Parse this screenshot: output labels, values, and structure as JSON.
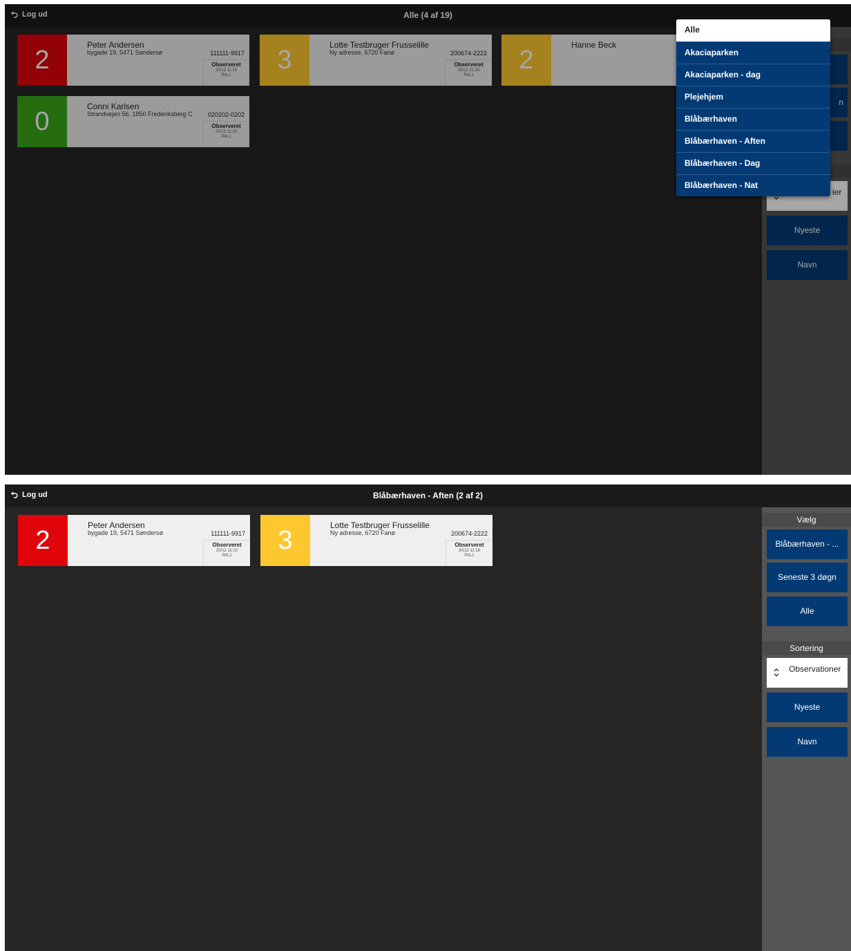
{
  "colors": {
    "red": "#e0040b",
    "yellow": "#fdc82f",
    "green": "#3aa71a",
    "blue": "#033a73",
    "background": "#252525",
    "topbar": "#1b1b1b",
    "sidebar": "#555555"
  },
  "common": {
    "logout_label": "Log ud",
    "logout_icon": "undo-arrow-icon"
  },
  "screen1": {
    "title": "Alle (4 af 19)",
    "patients": [
      {
        "score": "2",
        "color": "red",
        "name": "Peter Andersen",
        "address": "bygade 19, 5471 Søndersø",
        "id": "111111-9917",
        "obs_label": "Observeret",
        "obs_time": "20/12 11:15",
        "obs_code": "PAL1"
      },
      {
        "score": "3",
        "color": "yellow",
        "name": "Lotte Testbruger Frusselille",
        "address": "Ny adresse, 6720 Fanø",
        "id": "200674-2222",
        "obs_label": "Observeret",
        "obs_time": "20/12 11:16",
        "obs_code": "PAL1"
      },
      {
        "score": "2",
        "color": "yellow",
        "name": "Hanne Beck",
        "address": "",
        "id": "",
        "obs_label": "",
        "obs_time": "",
        "obs_code": ""
      },
      {
        "score": "0",
        "color": "green",
        "name": "Conni Karlsen",
        "address": "Strandvejen 56, 1850 Frederiksberg C",
        "id": "020202-0202",
        "obs_label": "Observeret",
        "obs_time": "20/12 11:15",
        "obs_code": "PAL1"
      }
    ],
    "dropdown": {
      "selected": "Alle",
      "options": [
        "Akaciaparken",
        "Akaciaparken - dag",
        "Plejehjem",
        "Blåbærhaven",
        "Blåbærhaven - Aften",
        "Blåbærhaven - Dag",
        "Blåbærhaven - Nat"
      ]
    },
    "sidebar_visible": {
      "sort_partial": "ier",
      "filter_partial": "n",
      "newest_label": "Nyeste",
      "name_label": "Navn"
    }
  },
  "screen2": {
    "title": "Blåbærhaven - Aften (2 af 2)",
    "patients": [
      {
        "score": "2",
        "color": "red",
        "name": "Peter Andersen",
        "address": "bygade 19, 5471 Søndersø",
        "id": "111111-9917",
        "obs_label": "Observeret",
        "obs_time": "20/12 11:15",
        "obs_code": "PAL1"
      },
      {
        "score": "3",
        "color": "yellow",
        "name": "Lotte Testbruger Frusselille",
        "address": "Ny adresse, 6720 Fanø",
        "id": "200674-2222",
        "obs_label": "Observeret",
        "obs_time": "20/12 11:16",
        "obs_code": "PAL1"
      }
    ],
    "sidebar": {
      "select_header": "Vælg",
      "unit_button": "Blåbærhaven - ...",
      "period_button": "Seneste 3 døgn",
      "all_button": "Alle",
      "sort_header": "Sortering",
      "sort_observations": "Observationer",
      "sort_newest": "Nyeste",
      "sort_name": "Navn"
    }
  }
}
